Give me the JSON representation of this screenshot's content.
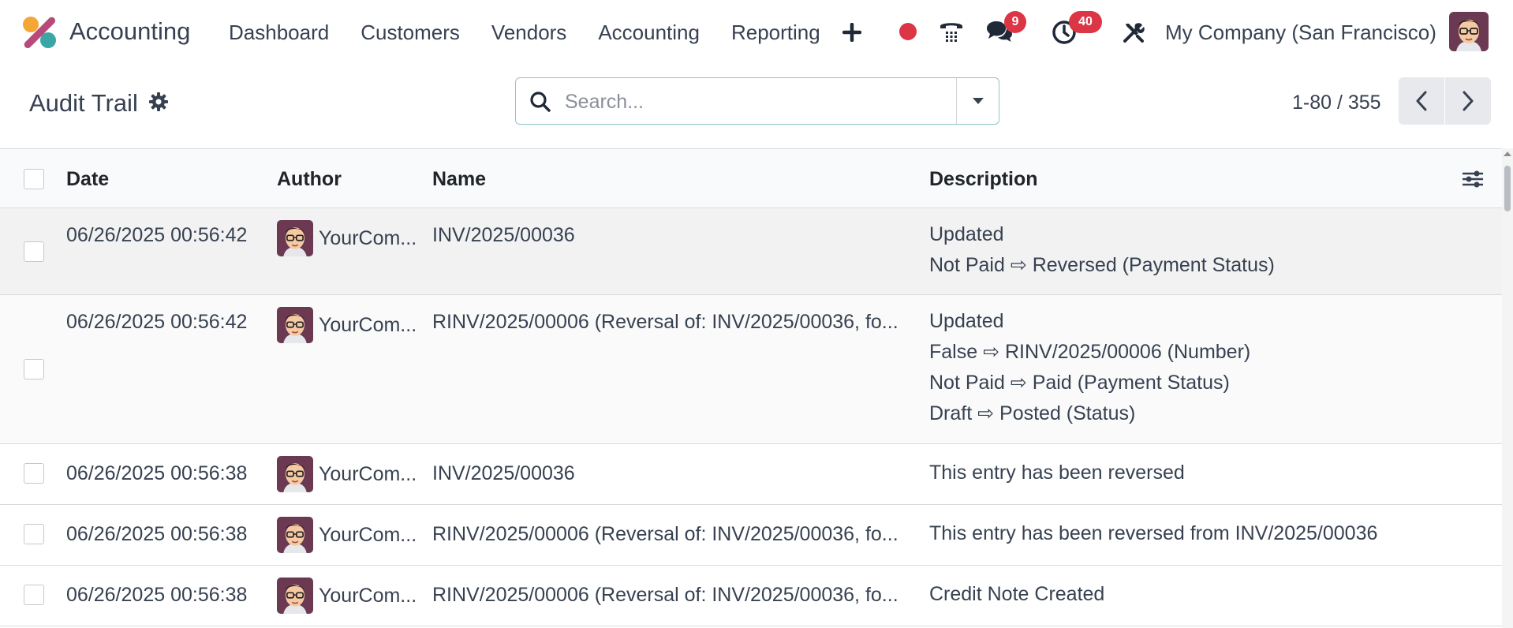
{
  "navbar": {
    "app_name": "Accounting",
    "menu": [
      "Dashboard",
      "Customers",
      "Vendors",
      "Accounting",
      "Reporting"
    ],
    "messages_count": "9",
    "activities_count": "40",
    "company": "My Company (San Francisco)",
    "icons": [
      "plus-icon",
      "record-dot-icon",
      "phone-icon",
      "chat-icon",
      "clock-icon",
      "tools-icon"
    ]
  },
  "control_panel": {
    "title": "Audit Trail",
    "search_placeholder": "Search...",
    "pager": "1-80 / 355"
  },
  "table": {
    "columns": [
      "Date",
      "Author",
      "Name",
      "Description"
    ],
    "rows": [
      {
        "date": "06/26/2025 00:56:42",
        "author": "YourCom...",
        "name": "INV/2025/00036",
        "description": [
          "Updated",
          "Not Paid ⇨ Reversed (Payment Status)"
        ]
      },
      {
        "date": "06/26/2025 00:56:42",
        "author": "YourCom...",
        "name": "RINV/2025/00006 (Reversal of: INV/2025/00036, fo...",
        "description": [
          "Updated",
          "False ⇨ RINV/2025/00006 (Number)",
          "Not Paid ⇨ Paid (Payment Status)",
          "Draft ⇨ Posted (Status)"
        ]
      },
      {
        "date": "06/26/2025 00:56:38",
        "author": "YourCom...",
        "name": "INV/2025/00036",
        "description": [
          "This entry has been reversed"
        ]
      },
      {
        "date": "06/26/2025 00:56:38",
        "author": "YourCom...",
        "name": "RINV/2025/00006 (Reversal of: INV/2025/00036, fo...",
        "description": [
          "This entry has been reversed from INV/2025/00036"
        ]
      },
      {
        "date": "06/26/2025 00:56:38",
        "author": "YourCom...",
        "name": "RINV/2025/00006 (Reversal of: INV/2025/00036, fo...",
        "description": [
          "Credit Note Created"
        ]
      }
    ]
  },
  "colors": {
    "badge": "#dc3545",
    "record_dot": "#dc3545",
    "search_border": "#8fc6c6",
    "avatar_bg": "#6b3a52"
  }
}
